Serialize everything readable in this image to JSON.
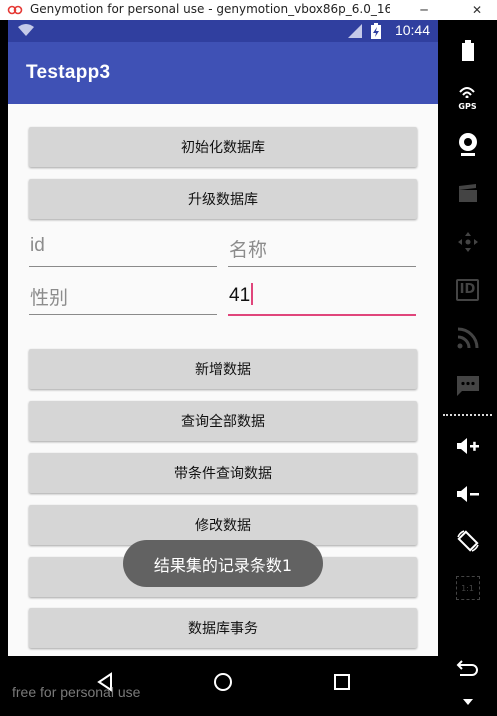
{
  "window": {
    "title": "Genymotion for personal use - genymotion_vbox86p_6.0_16...",
    "minimize": "─",
    "close": "✕"
  },
  "statusbar": {
    "time": "10:44"
  },
  "appbar": {
    "title": "Testapp3"
  },
  "buttons": {
    "init_db": "初始化数据库",
    "upgrade_db": "升级数据库",
    "add_data": "新增数据",
    "query_all": "查询全部数据",
    "query_cond": "带条件查询数据",
    "modify": "修改数据",
    "hidden_button": "",
    "transaction": "数据库事务"
  },
  "fields": {
    "id": {
      "placeholder": "id",
      "value": ""
    },
    "name": {
      "placeholder": "名称",
      "value": ""
    },
    "gender": {
      "placeholder": "性别",
      "value": ""
    },
    "age": {
      "placeholder": "",
      "value": "41"
    }
  },
  "toast": {
    "text": "结果集的记录条数1"
  },
  "navbar": {
    "watermark": "free for personal use"
  },
  "sidepanel": {
    "icons": [
      "battery-icon",
      "gps-icon",
      "camera-icon",
      "clapperboard-icon",
      "dpad-icon",
      "id-icon",
      "rss-icon",
      "sms-icon",
      "volume-up-icon",
      "volume-down-icon",
      "rotate-icon",
      "scale-icon",
      "back-icon"
    ],
    "gps_label": "GPS",
    "id_label": "ID",
    "scale_label": "1:1"
  },
  "colors": {
    "primary": "#3f51b5",
    "primary_dark": "#303f9f",
    "accent": "#e0457b",
    "button": "#d6d6d6",
    "toast": "#626262"
  }
}
